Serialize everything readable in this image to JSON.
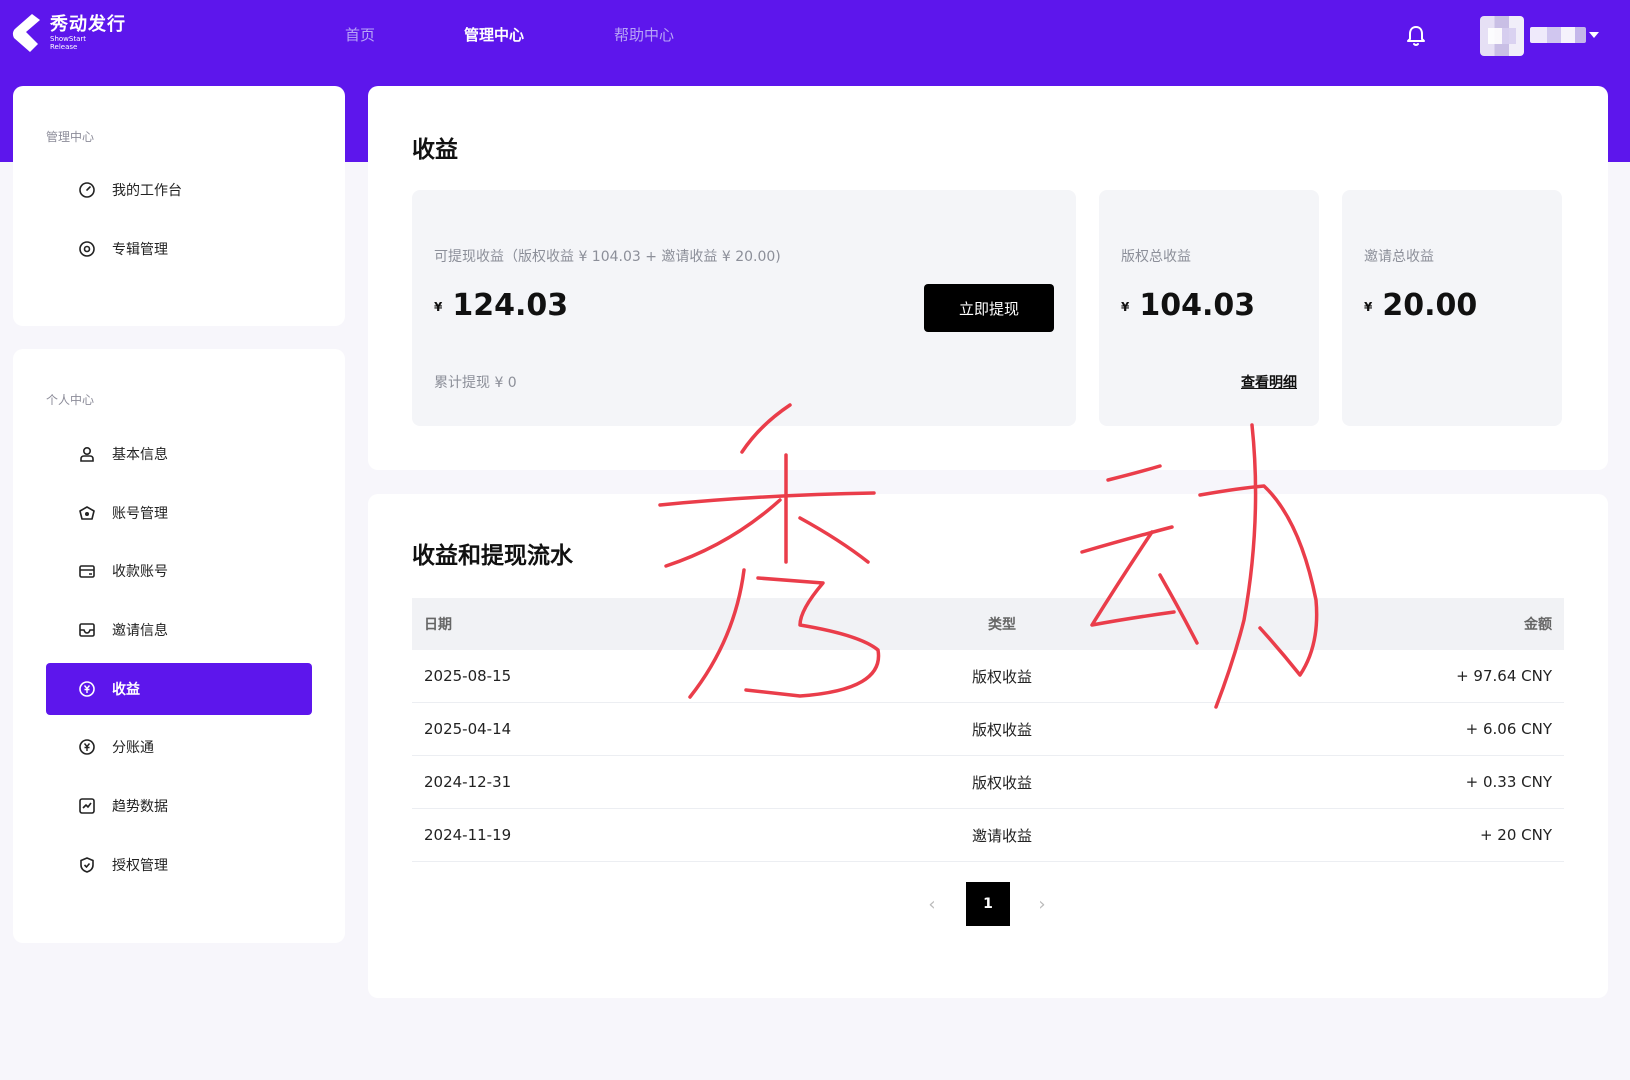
{
  "colors": {
    "brand": "#5d16ec",
    "ink": "#111111",
    "muted": "#8c8f99",
    "annotation": "#ea3d4a"
  },
  "header": {
    "logo_title": "秀动发行",
    "logo_sub1": "ShowStart",
    "logo_sub2": "Release",
    "nav": [
      "首页",
      "管理中心",
      "帮助中心"
    ],
    "active_nav": "管理中心",
    "icons": [
      "bell-icon",
      "chevron-down-icon"
    ]
  },
  "sidebar": {
    "group1_title": "管理中心",
    "group1_items": [
      {
        "label": "我的工作台",
        "icon": "dashboard-icon"
      },
      {
        "label": "专辑管理",
        "icon": "album-icon"
      }
    ],
    "group2_title": "个人中心",
    "group2_items": [
      {
        "label": "基本信息",
        "icon": "user-icon"
      },
      {
        "label": "账号管理",
        "icon": "account-icon"
      },
      {
        "label": "收款账号",
        "icon": "card-icon"
      },
      {
        "label": "邀请信息",
        "icon": "invite-icon"
      },
      {
        "label": "收益",
        "icon": "yuan-icon",
        "active": true
      },
      {
        "label": "分账通",
        "icon": "split-icon"
      },
      {
        "label": "趋势数据",
        "icon": "chart-icon"
      },
      {
        "label": "授权管理",
        "icon": "shield-icon"
      }
    ]
  },
  "earnings": {
    "title": "收益",
    "withdrawable": {
      "label": "可提现收益（版权收益 ¥ 104.03 + 邀请收益 ¥ 20.00)",
      "currency": "¥",
      "value": "124.03",
      "button": "立即提现",
      "cumulative": "累计提现 ¥ 0"
    },
    "copyright": {
      "label": "版权总收益",
      "currency": "¥",
      "value": "104.03",
      "link": "查看明细"
    },
    "invite": {
      "label": "邀请总收益",
      "currency": "¥",
      "value": "20.00"
    }
  },
  "ledger": {
    "title": "收益和提现流水",
    "columns": [
      "日期",
      "类型",
      "金额"
    ],
    "rows": [
      {
        "date": "2025-08-15",
        "type": "版权收益",
        "amount": "+ 97.64 CNY"
      },
      {
        "date": "2025-04-14",
        "type": "版权收益",
        "amount": "+ 6.06 CNY"
      },
      {
        "date": "2024-12-31",
        "type": "版权收益",
        "amount": "+ 0.33 CNY"
      },
      {
        "date": "2024-11-19",
        "type": "邀请收益",
        "amount": "+ 20 CNY"
      }
    ],
    "pagination": {
      "prev": "‹",
      "current": "1",
      "next": "›"
    }
  },
  "annotation": {
    "text": "秀动",
    "kind": "handwritten"
  }
}
